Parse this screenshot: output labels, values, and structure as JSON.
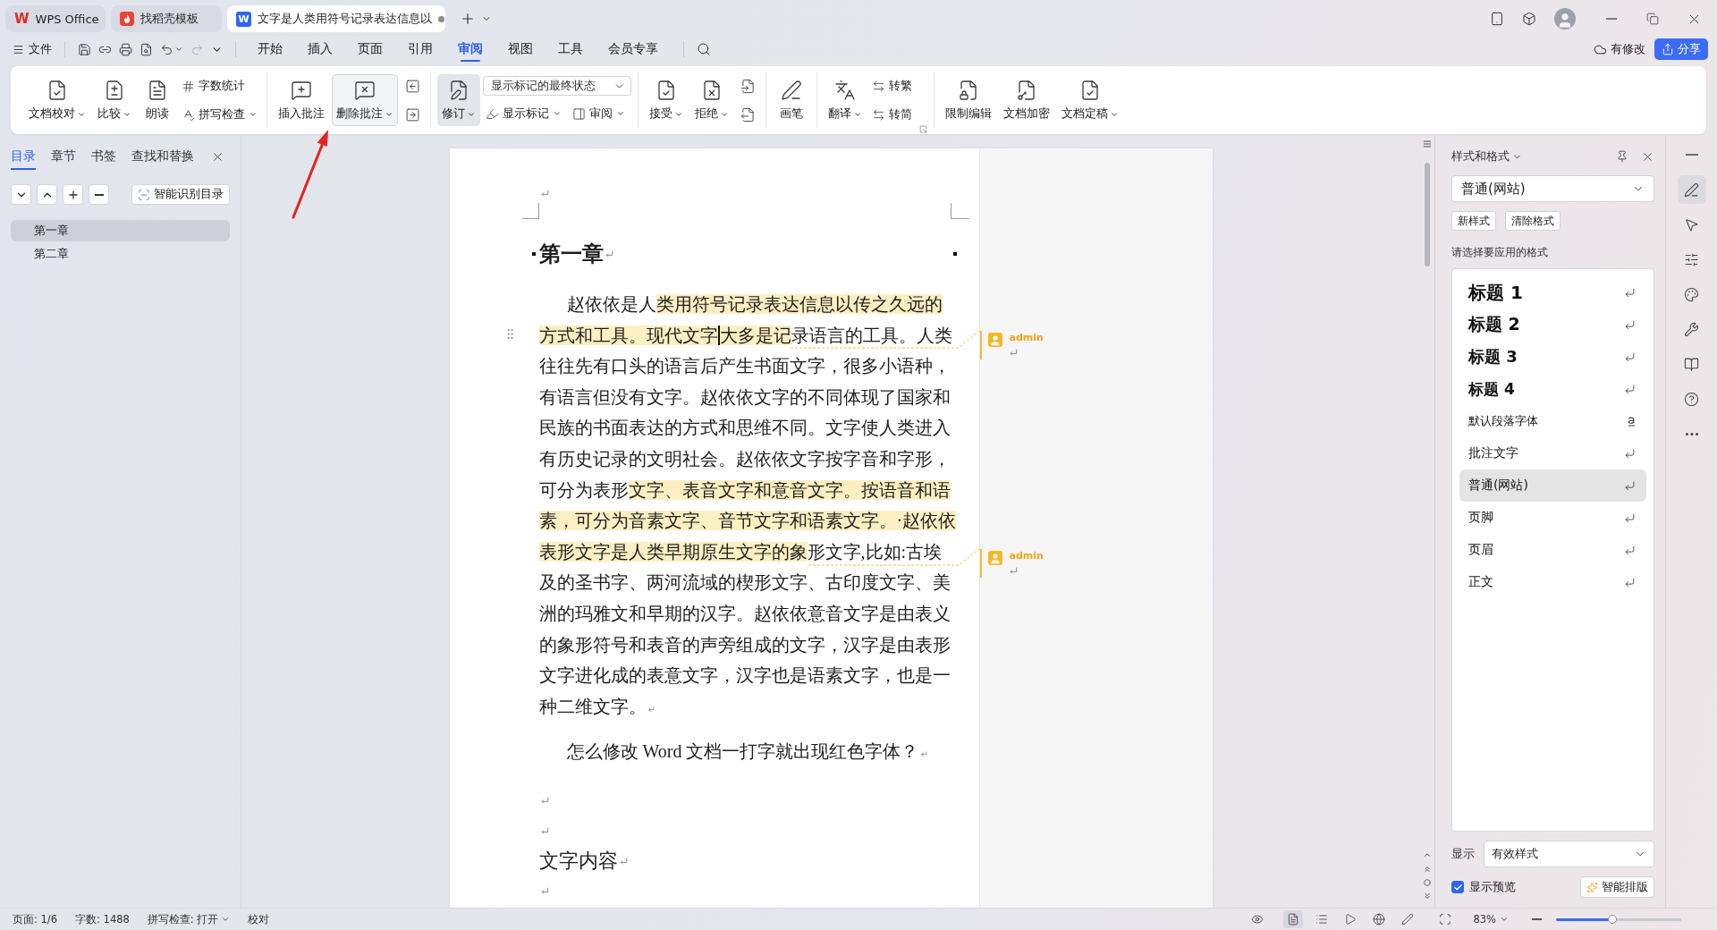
{
  "title_bar": {
    "tabs": [
      {
        "kind": "home",
        "badge": "W",
        "label": "WPS Office",
        "selected": false,
        "unsaved": false
      },
      {
        "kind": "template",
        "label": "找稻壳模板",
        "selected": false,
        "unsaved": false
      },
      {
        "kind": "document",
        "badge": "W",
        "label": "文字是人类用符号记录表达信息以",
        "selected": true,
        "unsaved": true
      }
    ]
  },
  "menu_bar": {
    "file": "文件",
    "tabs": [
      {
        "label": "开始",
        "selected": false
      },
      {
        "label": "插入",
        "selected": false
      },
      {
        "label": "页面",
        "selected": false
      },
      {
        "label": "引用",
        "selected": false
      },
      {
        "label": "审阅",
        "selected": true
      },
      {
        "label": "视图",
        "selected": false
      },
      {
        "label": "工具",
        "selected": false
      },
      {
        "label": "会员专享",
        "selected": false
      }
    ],
    "sync_status": "有修改",
    "share": "分享"
  },
  "ribbon": {
    "groups": [
      {
        "launcher": false,
        "columns": [
          {
            "kind": "large",
            "label": "文档校对",
            "dropdown": true,
            "pressed": false,
            "hovered": false
          },
          {
            "kind": "large",
            "label": "比较",
            "dropdown": true,
            "pressed": false,
            "hovered": false
          },
          {
            "kind": "large",
            "label": "朗读",
            "dropdown": false,
            "pressed": false,
            "hovered": false
          },
          {
            "kind": "stack",
            "rows": [
              [
                {
                  "kind": "small",
                  "label": "字数统计",
                  "dropdown": false
                }
              ],
              [
                {
                  "kind": "small",
                  "label": "拼写检查",
                  "dropdown": true
                }
              ]
            ]
          }
        ]
      },
      {
        "launcher": false,
        "columns": [
          {
            "kind": "large",
            "label": "插入批注",
            "dropdown": false,
            "pressed": false,
            "hovered": false
          },
          {
            "kind": "large",
            "label": "删除批注",
            "dropdown": true,
            "pressed": false,
            "hovered": true
          },
          {
            "kind": "stack",
            "rows": [
              [
                {
                  "kind": "icon"
                }
              ],
              [
                {
                  "kind": "icon"
                }
              ]
            ]
          }
        ]
      },
      {
        "launcher": false,
        "columns": [
          {
            "kind": "large",
            "label": "修订",
            "dropdown": true,
            "pressed": true,
            "hovered": false
          },
          {
            "kind": "stack",
            "rows": [
              [
                {
                  "kind": "select",
                  "value": "显示标记的最终状态"
                }
              ],
              [
                {
                  "kind": "small",
                  "label": "显示标记",
                  "dropdown": true
                },
                {
                  "kind": "small",
                  "label": "审阅",
                  "dropdown": true
                }
              ]
            ]
          }
        ]
      },
      {
        "launcher": false,
        "columns": [
          {
            "kind": "large",
            "label": "接受",
            "dropdown": true,
            "pressed": false,
            "hovered": false
          },
          {
            "kind": "large",
            "label": "拒绝",
            "dropdown": true,
            "pressed": false,
            "hovered": false
          },
          {
            "kind": "stack",
            "rows": [
              [
                {
                  "kind": "icon"
                }
              ],
              [
                {
                  "kind": "icon"
                }
              ]
            ]
          }
        ]
      },
      {
        "launcher": false,
        "columns": [
          {
            "kind": "large",
            "label": "画笔",
            "dropdown": false,
            "pressed": false,
            "hovered": false
          }
        ]
      },
      {
        "launcher": true,
        "columns": [
          {
            "kind": "large",
            "label": "翻译",
            "dropdown": true,
            "pressed": false,
            "hovered": false
          },
          {
            "kind": "stack",
            "rows": [
              [
                {
                  "kind": "small",
                  "label": "转繁",
                  "dropdown": false
                }
              ],
              [
                {
                  "kind": "small",
                  "label": "转简",
                  "dropdown": false
                }
              ]
            ]
          }
        ]
      },
      {
        "launcher": false,
        "columns": [
          {
            "kind": "large",
            "label": "限制编辑",
            "dropdown": false,
            "pressed": false,
            "hovered": false
          },
          {
            "kind": "large",
            "label": "文档加密",
            "dropdown": false,
            "pressed": false,
            "hovered": false
          },
          {
            "kind": "large",
            "label": "文档定稿",
            "dropdown": true,
            "pressed": false,
            "hovered": false
          }
        ]
      }
    ]
  },
  "nav_panel": {
    "tabs": [
      {
        "label": "目录",
        "selected": true
      },
      {
        "label": "章节",
        "selected": false
      },
      {
        "label": "书签",
        "selected": false
      },
      {
        "label": "查找和替换",
        "selected": false
      }
    ],
    "smart_button": "智能识别目录",
    "outline": [
      {
        "label": "第一章",
        "selected": true
      },
      {
        "label": "第二章",
        "selected": false
      }
    ]
  },
  "document": {
    "show_marks": true,
    "blocks": [
      {
        "kind": "heading",
        "text": "第一章"
      },
      {
        "kind": "paragraph",
        "end_mark": "↵",
        "segments": [
          {
            "text": "赵依依是人",
            "highlighted": false,
            "caret": false
          },
          {
            "text": "类用符号记录表达信息以传之久远的方式和工具。现代文字",
            "highlighted": true,
            "caret": false
          },
          {
            "text": "大多是记",
            "highlighted": true,
            "caret": true
          },
          {
            "text": "录语言的工具。人类往往先有口头的语言后产生书面文字，很多小语种，有语言但没有文字。赵依依文字的不同体现了国家和民族的书面表达的方式和思维不同。文字使人类进入有历史记录的文明社会。赵依依文字按字音和字形，可分为表形",
            "highlighted": false,
            "caret": false
          },
          {
            "text": "文字、表音文字和意音文字。按语音和语素，可分为音素文字、音节文字和语素文字。·赵依依表形文字是人类早期原生文字的象",
            "highlighted": true,
            "caret": false
          },
          {
            "text": "形文字,比如:古埃及的圣书字、两河流域的楔形文字、古印度文字、美洲的玛雅文和早期的汉字。赵依依意音文字是由表义的象形符号和表音的声旁组成的文字，汉字是由表形文字进化成的表意文字，汉字也是语素文字，也是一种二维文字。",
            "highlighted": false,
            "caret": false
          }
        ]
      },
      {
        "kind": "paragraph",
        "end_mark": "↵",
        "segments": [
          {
            "text": "怎么修改 Word 文档一打字就出现红色字体？",
            "highlighted": false,
            "caret": false
          }
        ]
      },
      {
        "kind": "empty"
      },
      {
        "kind": "empty"
      },
      {
        "kind": "title",
        "text": "文字内容"
      },
      {
        "kind": "empty"
      }
    ],
    "comments": [
      {
        "author": "admin"
      },
      {
        "author": "admin"
      }
    ]
  },
  "styles_panel": {
    "title": "样式和格式",
    "current": "普通(网站)",
    "buttons": [
      "新样式",
      "清除格式"
    ],
    "prompt": "请选择要应用的格式",
    "styles": [
      {
        "name": "标题 1",
        "kind": "heading1",
        "selected": false
      },
      {
        "name": "标题 2",
        "kind": "heading2",
        "selected": false
      },
      {
        "name": "标题 3",
        "kind": "heading3",
        "selected": false
      },
      {
        "name": "标题 4",
        "kind": "heading4",
        "selected": false
      },
      {
        "name": "默认段落字体",
        "kind": "character",
        "selected": false
      },
      {
        "name": "批注文字",
        "kind": "paragraph",
        "selected": false
      },
      {
        "name": "普通(网站)",
        "kind": "paragraph",
        "selected": true
      },
      {
        "name": "页脚",
        "kind": "paragraph",
        "selected": false
      },
      {
        "name": "页眉",
        "kind": "paragraph",
        "selected": false
      },
      {
        "name": "正文",
        "kind": "paragraph",
        "selected": false
      }
    ],
    "show_label": "显示",
    "show_value": "有效样式",
    "preview": {
      "label": "显示预览",
      "checked": true
    },
    "smart_button": "智能排版"
  },
  "side_rail": {
    "items": [
      {
        "selected": false
      },
      {
        "selected": true
      },
      {
        "selected": false
      },
      {
        "selected": false
      },
      {
        "selected": false
      },
      {
        "selected": false
      },
      {
        "selected": false
      },
      {
        "selected": false
      },
      {
        "selected": false
      }
    ]
  },
  "status_bar": {
    "items": [
      {
        "label": "页面: 1/6",
        "dropdown": false
      },
      {
        "label": "字数: 1488",
        "dropdown": false
      },
      {
        "label": "拼写检查: 打开",
        "dropdown": true
      },
      {
        "label": "校对",
        "dropdown": false
      }
    ],
    "views": [
      {
        "selected": false
      },
      {
        "selected": true
      },
      {
        "selected": false
      },
      {
        "selected": false
      },
      {
        "selected": false
      },
      {
        "selected": false
      }
    ],
    "zoom": "83%",
    "zoom_slider": {
      "level": 0.45
    }
  }
}
